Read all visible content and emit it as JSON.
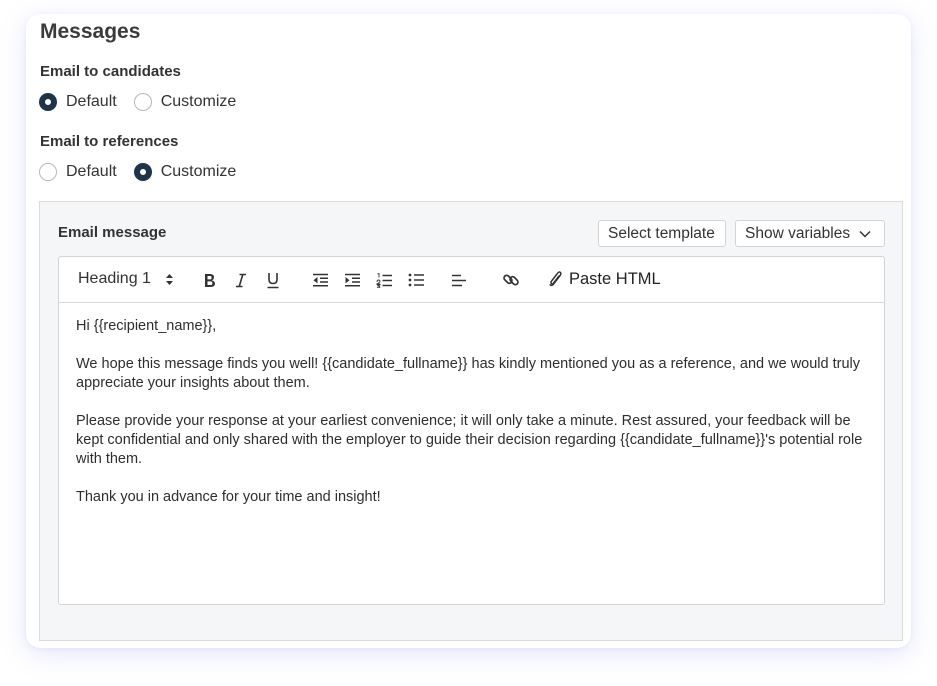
{
  "section_title": "Messages",
  "candidates": {
    "label": "Email to candidates",
    "options": [
      {
        "label": "Default",
        "checked": true
      },
      {
        "label": "Customize",
        "checked": false
      }
    ]
  },
  "references": {
    "label": "Email to references",
    "options": [
      {
        "label": "Default",
        "checked": false
      },
      {
        "label": "Customize",
        "checked": true
      }
    ]
  },
  "email_panel": {
    "title": "Email message",
    "select_template_label": "Select template",
    "show_variables_label": "Show variables"
  },
  "toolbar": {
    "heading_value": "Heading 1",
    "tools": [
      "bold-icon",
      "italic-icon",
      "underline-icon",
      "outdent-icon",
      "indent-icon",
      "ordered-list-icon",
      "bullet-list-icon",
      "align-left-icon",
      "link-icon",
      "paperclip-icon"
    ],
    "paste_html_label": "Paste HTML"
  },
  "message": {
    "greeting": "Hi {{recipient_name}},",
    "paragraph_1": "We hope this message finds you well! {{candidate_fullname}} has kindly mentioned you as a reference, and we would truly appreciate your insights about them.",
    "paragraph_2": "Please provide your response at your earliest convenience; it will only take a minute. Rest assured, your feedback will be kept confidential and only shared with the employer to guide their decision regarding {{candidate_fullname}}'s potential role with them.",
    "closing": "Thank you in advance for your time and insight!"
  },
  "colors": {
    "radio_checked": "#1f3349",
    "panel_background": "#f5f6f8",
    "card_shadow": "#828cf0"
  }
}
